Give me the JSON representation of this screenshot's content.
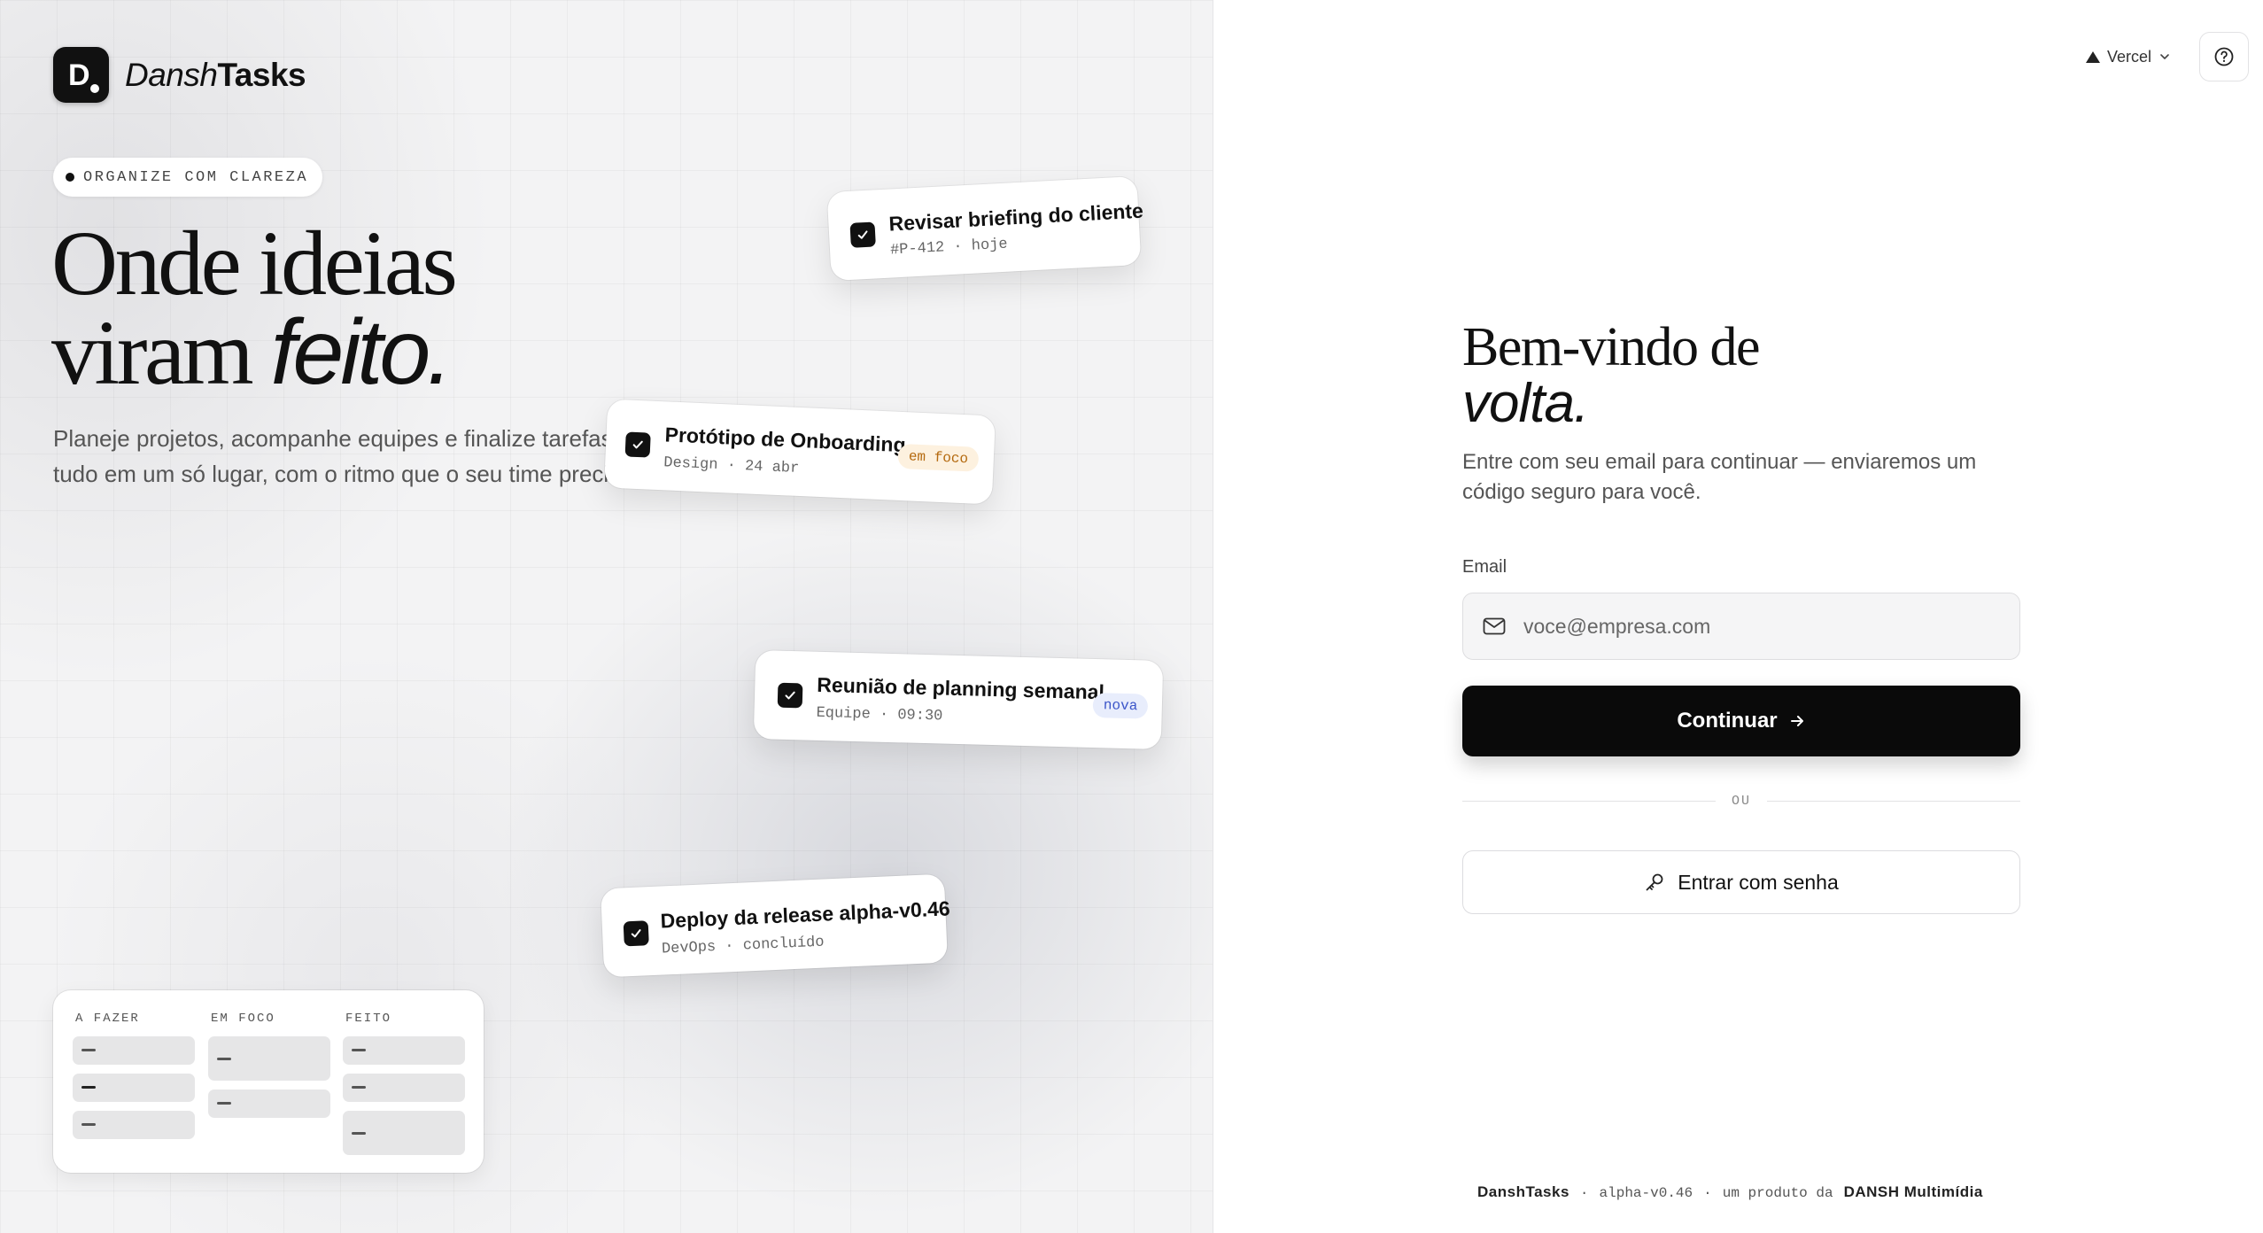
{
  "brand": {
    "name_italic": "Dansh",
    "name_bold": "Tasks",
    "logo_glyph": "D"
  },
  "eyebrow": "ORGANIZE COM CLAREZA",
  "hero": {
    "line1": "Onde ideias",
    "line2_plain": "viram ",
    "line2_italic": "feito."
  },
  "hero_sub": "Planeje projetos, acompanhe equipes e finalize tarefas — tudo em um só lugar, com o ritmo que o seu time precisa.",
  "task_cards": [
    {
      "title": "Revisar briefing do cliente",
      "meta": "#P-412 · hoje",
      "tag": ""
    },
    {
      "title": "Protótipo de Onboarding",
      "meta": "Design · 24 abr",
      "tag": "em foco",
      "tag_color": "#b4690e",
      "tag_bg": "#fdf1df"
    },
    {
      "title": "Reunião de planning semanal",
      "meta": "Equipe · 09:30",
      "tag": "nova",
      "tag_color": "#3b55c9",
      "tag_bg": "#e8edfc"
    },
    {
      "title": "Deploy da release alpha-v0.46",
      "meta": "DevOps · concluído",
      "tag": ""
    }
  ],
  "board": {
    "columns": [
      {
        "header": "A FAZER",
        "cards": 3
      },
      {
        "header": "EM FOCO",
        "cards": 2
      },
      {
        "header": "FEITO",
        "cards": 3
      }
    ]
  },
  "topbar": {
    "team": "Vercel",
    "team_icon": "triangle-logo-icon",
    "help_icon": "help-circle-icon"
  },
  "login": {
    "title_line1": "Bem-vindo de",
    "title_line2_italic": "volta.",
    "subtitle": "Entre com seu email para continuar — enviaremos um código seguro para você.",
    "email_label": "Email",
    "email_placeholder": "voce@empresa.com",
    "email_value": "",
    "continue_label": "Continuar",
    "divider_label": "OU",
    "password_label": "Entrar com senha"
  },
  "footer": {
    "product": "DanshTasks",
    "version": "alpha-v0.46",
    "by": "um produto da",
    "company": "DANSH Multimídia",
    "sep": "·"
  },
  "colors": {
    "accent": "#0a0a0a",
    "background_left": "#f3f3f4",
    "background_right": "#ffffff"
  }
}
